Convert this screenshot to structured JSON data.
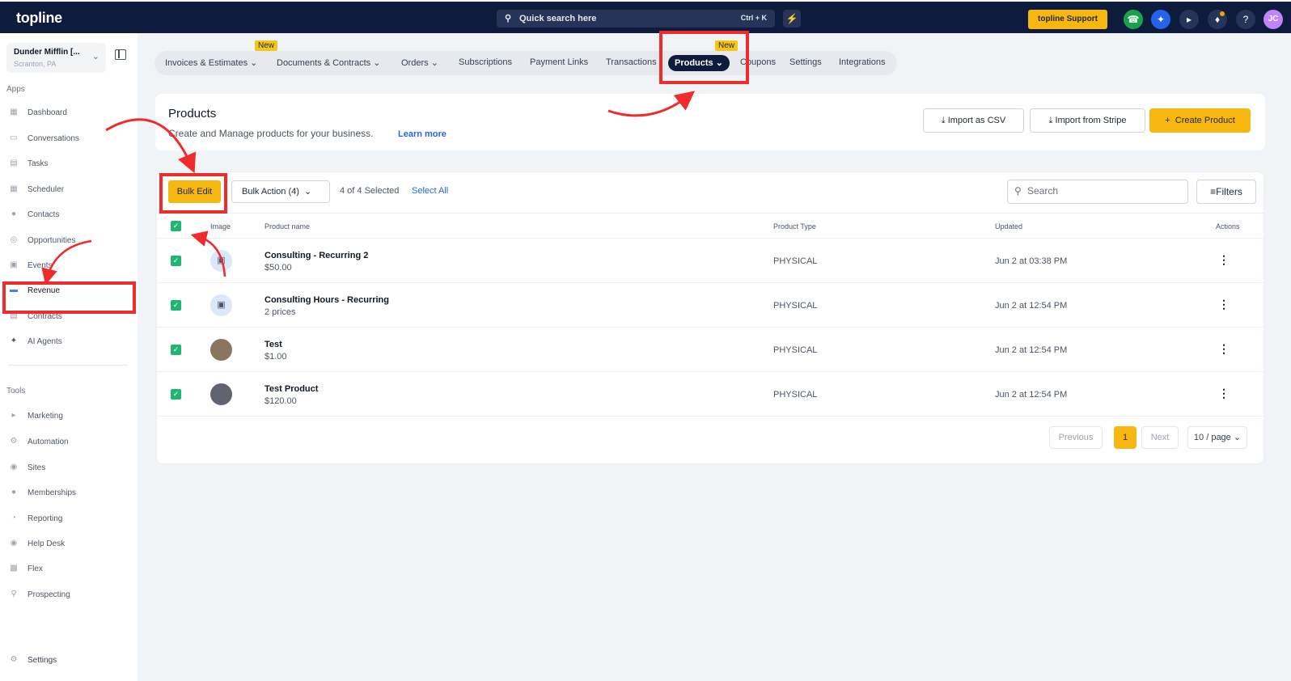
{
  "topbar": {
    "logo": "topline",
    "search_label": "Quick search here",
    "search_shortcut": "Ctrl + K",
    "support_label": "topline Support",
    "avatar_initials": "JC"
  },
  "sidebar": {
    "location_name": "Dunder Mifflin [...",
    "location_city": "Scranton, PA",
    "apps_label": "Apps",
    "tools_label": "Tools",
    "apps": [
      {
        "label": "Dashboard",
        "icon": "dashboard-icon"
      },
      {
        "label": "Conversations",
        "icon": "chat-icon"
      },
      {
        "label": "Tasks",
        "icon": "tasks-icon"
      },
      {
        "label": "Scheduler",
        "icon": "calendar-icon"
      },
      {
        "label": "Contacts",
        "icon": "contacts-icon"
      },
      {
        "label": "Opportunities",
        "icon": "target-icon"
      },
      {
        "label": "Events",
        "icon": "events-icon"
      },
      {
        "label": "Revenue",
        "icon": "card-icon"
      },
      {
        "label": "Contracts",
        "icon": "document-icon"
      },
      {
        "label": "AI Agents",
        "icon": "sparkle-icon"
      }
    ],
    "tools": [
      {
        "label": "Marketing",
        "icon": "megaphone-icon"
      },
      {
        "label": "Automation",
        "icon": "automation-icon"
      },
      {
        "label": "Sites",
        "icon": "globe-icon"
      },
      {
        "label": "Memberships",
        "icon": "members-icon"
      },
      {
        "label": "Reporting",
        "icon": "pie-chart-icon"
      },
      {
        "label": "Help Desk",
        "icon": "help-icon"
      },
      {
        "label": "Flex",
        "icon": "flex-icon"
      },
      {
        "label": "Prospecting",
        "icon": "search-icon"
      }
    ],
    "settings_label": "Settings"
  },
  "tabs": [
    {
      "label": "Invoices & Estimates",
      "dropdown": true
    },
    {
      "label": "Documents & Contracts",
      "dropdown": true
    },
    {
      "label": "Orders",
      "dropdown": true
    },
    {
      "label": "Subscriptions"
    },
    {
      "label": "Payment Links"
    },
    {
      "label": "Transactions"
    },
    {
      "label": "Products",
      "dropdown": true,
      "active": true
    },
    {
      "label": "Coupons"
    },
    {
      "label": "Settings"
    },
    {
      "label": "Integrations"
    }
  ],
  "new_badge": "New",
  "header": {
    "title": "Products",
    "description": "Create and Manage products for your business.",
    "learn_more": "Learn more",
    "import_csv": "Import as CSV",
    "import_stripe": "Import from Stripe",
    "create_product": "Create Product"
  },
  "toolbar": {
    "bulk_edit": "Bulk Edit",
    "bulk_action": "Bulk Action (4)",
    "selected_count": "4 of 4 Selected",
    "select_all": "Select All",
    "search_placeholder": "Search",
    "filters": "Filters"
  },
  "table": {
    "columns": [
      "Image",
      "Product name",
      "Product Type",
      "Updated",
      "Actions"
    ],
    "rows": [
      {
        "name": "Consulting - Recurring 2",
        "sub": "$50.00",
        "type": "PHYSICAL",
        "updated": "Jun 2 at 03:38 PM",
        "checked": true
      },
      {
        "name": "Consulting Hours - Recurring",
        "sub": "2 prices",
        "type": "PHYSICAL",
        "updated": "Jun 2 at 12:54 PM",
        "checked": true
      },
      {
        "name": "Test",
        "sub": "$1.00",
        "type": "PHYSICAL",
        "updated": "Jun 2 at 12:54 PM",
        "checked": true
      },
      {
        "name": "Test Product",
        "sub": "$120.00",
        "type": "PHYSICAL",
        "updated": "Jun 2 at 12:54 PM",
        "checked": true
      }
    ]
  },
  "pagination": {
    "previous": "Previous",
    "current": "1",
    "next": "Next",
    "page_size": "10 / page"
  },
  "colors": {
    "brand_navy": "#0d1b3d",
    "accent_yellow": "#f5b710",
    "checkbox_green": "#21b573",
    "annotation_red": "#ef2b2b"
  }
}
